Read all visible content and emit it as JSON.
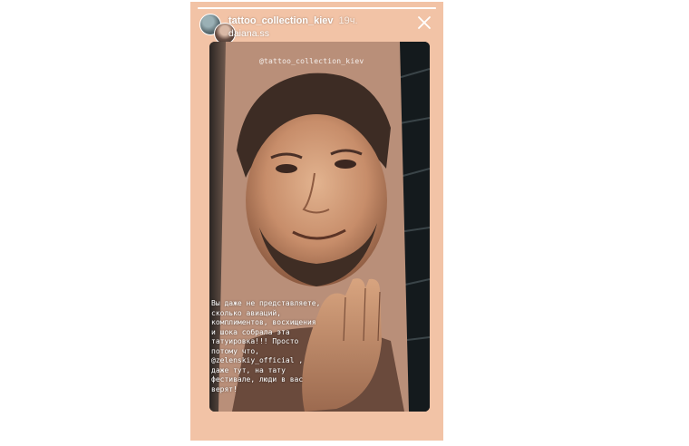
{
  "story": {
    "progress": 1.0,
    "header": {
      "username": "tattoo_collection_kiev",
      "time": "19ч.",
      "reposted_from": "daiana.ss",
      "avatar_icons": [
        "account-avatar-icon",
        "reposter-avatar-icon"
      ],
      "close_icon": "close-icon"
    },
    "mention_sticker": "@tattoo_collection_kiev",
    "caption": "Вы даже не представляете,\nсколько авиаций,\nкомплиментов, восхищения\nи шока собрала эта\nтатуировка!!! Просто\nпотому что,\n@zelenskiy_official ,\nдаже тут, на тату\nфестивале, люди в вас\nверят!"
  },
  "colors": {
    "frame_background": "#f2c3a6",
    "text": "#ffffff",
    "progress_track": "rgba(255,255,255,0.45)"
  }
}
